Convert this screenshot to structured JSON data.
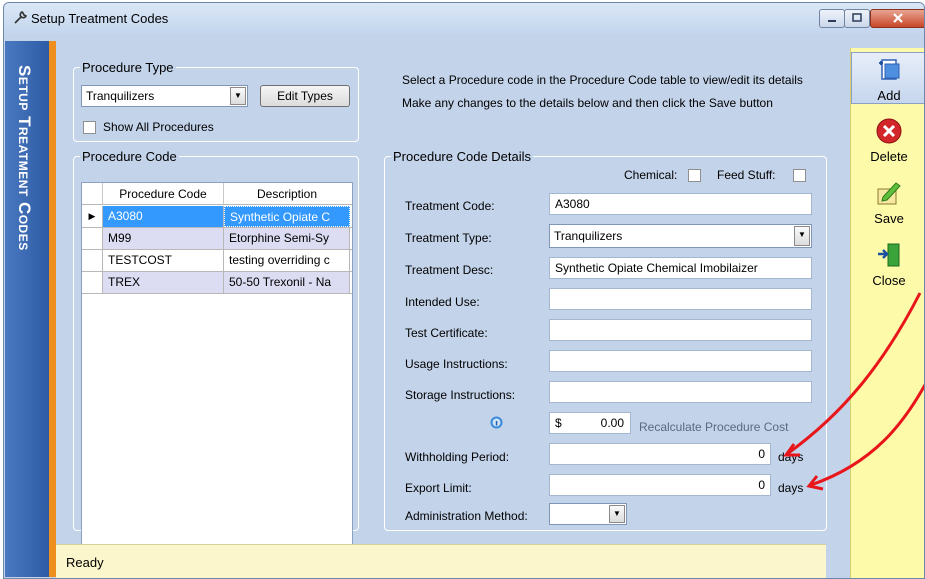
{
  "window": {
    "title": "Setup Treatment Codes"
  },
  "sidebar": {
    "label": "Setup Treatment Codes"
  },
  "instructions": {
    "line1": "Select a Procedure code in the Procedure Code table to view/edit its details",
    "line2": "Make any changes to the details below and then click the Save button"
  },
  "procedure_type": {
    "legend": "Procedure Type",
    "selected": "Tranquilizers",
    "edit_button": "Edit Types",
    "show_all_label": "Show All Procedures",
    "show_all_checked": false
  },
  "procedure_code": {
    "legend": "Procedure Code",
    "columns": [
      "Procedure Code",
      "Description"
    ],
    "rows": [
      {
        "code": "A3080",
        "description": "Synthetic Opiate C",
        "selected": true
      },
      {
        "code": "M99",
        "description": "Etorphine Semi-Sy",
        "selected": false
      },
      {
        "code": "TESTCOST",
        "description": "testing overriding c",
        "selected": false
      },
      {
        "code": "TREX",
        "description": "50-50 Trexonil - Na",
        "selected": false
      }
    ]
  },
  "details": {
    "legend": "Procedure Code Details",
    "chemical_label": "Chemical:",
    "feed_stuff_label": "Feed Stuff:",
    "treatment_code_label": "Treatment Code:",
    "treatment_code_value": "A3080",
    "treatment_type_label": "Treatment Type:",
    "treatment_type_value": "Tranquilizers",
    "treatment_desc_label": "Treatment Desc:",
    "treatment_desc_value": "Synthetic Opiate Chemical Imobilaizer",
    "intended_use_label": "Intended Use:",
    "intended_use_value": "",
    "test_certificate_label": "Test Certificate:",
    "test_certificate_value": "",
    "usage_instructions_label": "Usage Instructions:",
    "usage_instructions_value": "",
    "storage_instructions_label": "Storage Instructions:",
    "storage_instructions_value": "",
    "cost_currency": "$",
    "cost_value": "0.00",
    "recalculate_label": "Recalculate Procedure Cost",
    "withholding_label": "Withholding Period:",
    "withholding_value": "0",
    "withholding_unit": "days",
    "export_label": "Export Limit:",
    "export_value": "0",
    "export_unit": "days",
    "administration_label": "Administration Method:",
    "administration_value": ""
  },
  "toolbar": {
    "add": "Add",
    "delete": "Delete",
    "save": "Save",
    "close": "Close"
  },
  "status": {
    "text": "Ready"
  },
  "colors": {
    "accent_blue": "#3a6bb5",
    "accent_orange": "#ee8e1c",
    "toolbar_yellow": "#fdfaa9",
    "annotation_red": "#e8161b",
    "selection_blue": "#3399ff"
  }
}
